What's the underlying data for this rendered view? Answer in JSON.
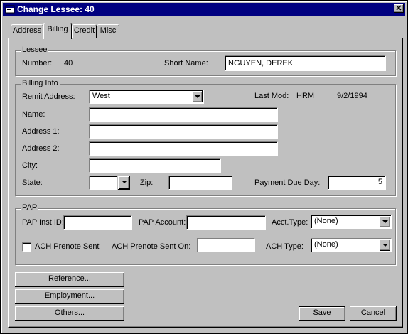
{
  "window": {
    "title": "Change Lessee: 40",
    "close_glyph": "✕"
  },
  "tabs": [
    {
      "label": "Address",
      "active": false
    },
    {
      "label": "Billing",
      "active": true
    },
    {
      "label": "Credit",
      "active": false
    },
    {
      "label": "Misc",
      "active": false
    }
  ],
  "lessee": {
    "group_label": "Lessee",
    "number_label": "Number:",
    "number_value": "40",
    "short_name_label": "Short Name:",
    "short_name_value": "NGUYEN, DEREK"
  },
  "billing": {
    "group_label": "Billing Info",
    "remit_label": "Remit Address:",
    "remit_value": "West",
    "last_mod_label": "Last Mod:",
    "last_mod_user": "HRM",
    "last_mod_date": "9/2/1994",
    "name_label": "Name:",
    "name_value": "",
    "address1_label": "Address 1:",
    "address1_value": "",
    "address2_label": "Address 2:",
    "address2_value": "",
    "city_label": "City:",
    "city_value": "",
    "state_label": "State:",
    "state_value": "",
    "zip_label": "Zip:",
    "zip_value": "",
    "payment_due_label": "Payment Due Day:",
    "payment_due_value": "5"
  },
  "pap": {
    "group_label": "PAP",
    "inst_id_label": "PAP Inst ID:",
    "inst_id_value": "",
    "account_label": "PAP Account:",
    "account_value": "",
    "acct_type_label": "Acct.Type:",
    "acct_type_value": "(None)",
    "ach_prenote_label": "ACH Prenote Sent",
    "ach_prenote_checked": false,
    "ach_prenote_on_label": "ACH Prenote Sent On:",
    "ach_prenote_on_value": "",
    "ach_type_label": "ACH Type:",
    "ach_type_value": "(None)"
  },
  "buttons": {
    "reference": "Reference...",
    "employment": "Employment...",
    "others": "Others...",
    "save": "Save",
    "cancel": "Cancel"
  },
  "icons": {
    "app": "app-window-icon",
    "close": "close-icon",
    "dropdown": "chevron-down-icon"
  },
  "colors": {
    "titlebar": "#000080",
    "face": "#c0c0c0"
  }
}
